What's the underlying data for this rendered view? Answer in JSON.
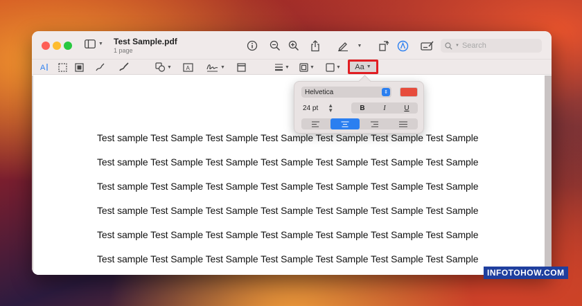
{
  "window": {
    "doc_name": "Test Sample.pdf",
    "page_count": "1 page"
  },
  "toolbar": {
    "search_placeholder": "Search",
    "icons": [
      "sidebar-icon",
      "info-icon",
      "zoom-out-icon",
      "zoom-in-icon",
      "share-icon",
      "highlight-pen-icon",
      "rotate-icon",
      "markup-icon",
      "form-fill-icon"
    ]
  },
  "markup_toolbar": {
    "text_style_label": "Aa"
  },
  "font_popover": {
    "font_family": "Helvetica",
    "font_size": "24 pt",
    "bold_label": "B",
    "italic_label": "I",
    "underline_label": "U",
    "text_color": "#e74c3c",
    "alignment": "center"
  },
  "document": {
    "lines": [
      "Test sample Test Sample Test Sample Test Sample Test Sample Test Sample Test Sample",
      "Test sample Test Sample Test Sample Test Sample Test Sample Test Sample Test Sample",
      "Test sample Test Sample Test Sample Test Sample Test Sample Test Sample Test Sample",
      "Test sample Test Sample Test Sample Test Sample Test Sample Test Sample Test Sample",
      "Test sample Test Sample Test Sample Test Sample Test Sample Test Sample Test Sample",
      "Test sample Test Sample Test Sample Test Sample Test Sample Test Sample Test Sample"
    ]
  },
  "watermark": {
    "text": "INFOTOHOW.COM"
  },
  "colors": {
    "highlight_border": "#e11d22",
    "accent_blue": "#2b7ff0"
  }
}
